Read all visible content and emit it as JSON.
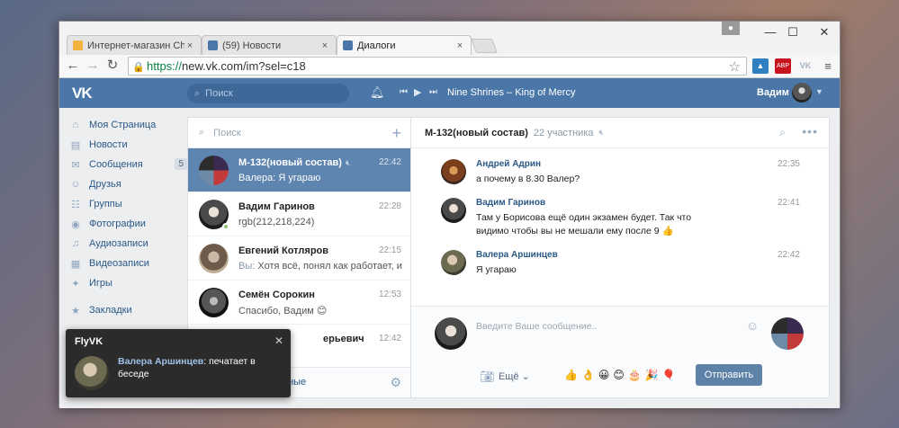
{
  "browser": {
    "tabs": [
      {
        "label": "Интернет-магазин Chrom",
        "close": "×",
        "favicon_color": "#f3b33d"
      },
      {
        "label": "(59) Новости",
        "close": "×",
        "favicon_color": "#4a76a8"
      },
      {
        "label": "Диалоги",
        "close": "×",
        "favicon_color": "#4a76a8"
      }
    ],
    "window_controls": {
      "minimize": "—",
      "maximize": "☐",
      "close": "✕"
    },
    "url_scheme": "https://",
    "url_rest": "new.vk.com/im?sel=c18",
    "extensions": [
      {
        "name": "picture-icon",
        "label": "",
        "color": "#2f7fc1"
      },
      {
        "name": "adblock-icon",
        "label": "ABP",
        "color": "#c8141e"
      },
      {
        "name": "vk-icon",
        "label": "VK",
        "color": "#a7b3c1"
      }
    ]
  },
  "vk": {
    "logo": "VK",
    "search_placeholder": "Поиск",
    "track": "Nine Shrines – King of Mercy",
    "user_name": "Вадим"
  },
  "nav": [
    {
      "label": "Моя Страница",
      "icon": "home-icon",
      "glyph": "⌂"
    },
    {
      "label": "Новости",
      "icon": "news-icon",
      "glyph": "▤"
    },
    {
      "label": "Сообщения",
      "icon": "messages-icon",
      "glyph": "✉",
      "badge": "5"
    },
    {
      "label": "Друзья",
      "icon": "friends-icon",
      "glyph": "☺"
    },
    {
      "label": "Группы",
      "icon": "groups-icon",
      "glyph": "☷"
    },
    {
      "label": "Фотографии",
      "icon": "photos-icon",
      "glyph": "◉"
    },
    {
      "label": "Аудиозаписи",
      "icon": "audio-icon",
      "glyph": "♫"
    },
    {
      "label": "Видеозаписи",
      "icon": "video-icon",
      "glyph": "▦"
    },
    {
      "label": "Игры",
      "icon": "games-icon",
      "glyph": "✦"
    },
    {
      "label": "Закладки",
      "icon": "bookmarks-icon",
      "glyph": "★"
    }
  ],
  "dialogs": {
    "search_placeholder": "Поиск",
    "items": [
      {
        "name": "М-132(новый состав)",
        "time": "22:42",
        "from": "Валера:",
        "text": "Я угараю",
        "active": true,
        "muted": true
      },
      {
        "name": "Вадим Гаринов",
        "time": "22:28",
        "from": "",
        "text": "rgb(212,218,224)",
        "online": true
      },
      {
        "name": "Евгений Котляров",
        "time": "22:15",
        "from": "Вы:",
        "text": "Хотя всё, понял как работает, изв..."
      },
      {
        "name": "Семён Сорокин",
        "time": "12:53",
        "from": "",
        "text": "Спасибо, Вадим 😊"
      },
      {
        "name": "ерьевич",
        "time": "12:42",
        "from": "",
        "text": ""
      }
    ],
    "footer_link": "нные"
  },
  "chat": {
    "title": "М-132(новый состав)",
    "count": "22 участника",
    "messages": [
      {
        "author": "Андрей Адрин",
        "time": "22:35",
        "text": "а почему в 8.30 Валер?"
      },
      {
        "author": "Вадим Гаринов",
        "time": "22:41",
        "text": "Там у Борисова ещё один экзамен будет. Так что видимо чтобы вы не мешали ему после 9 👍"
      },
      {
        "author": "Валера Аршинцев",
        "time": "22:42",
        "text": "Я угараю"
      }
    ],
    "input_placeholder": "Введите Ваше сообщение..",
    "more_label": "Ещё ⌄",
    "emojis": "👍👌😀😊🎂🎉🎈",
    "send_label": "Отправить"
  },
  "toast": {
    "title": "FlyVK",
    "close": "✕",
    "author": "Валера Аршинцев",
    "text": ": печатает в беседе"
  }
}
